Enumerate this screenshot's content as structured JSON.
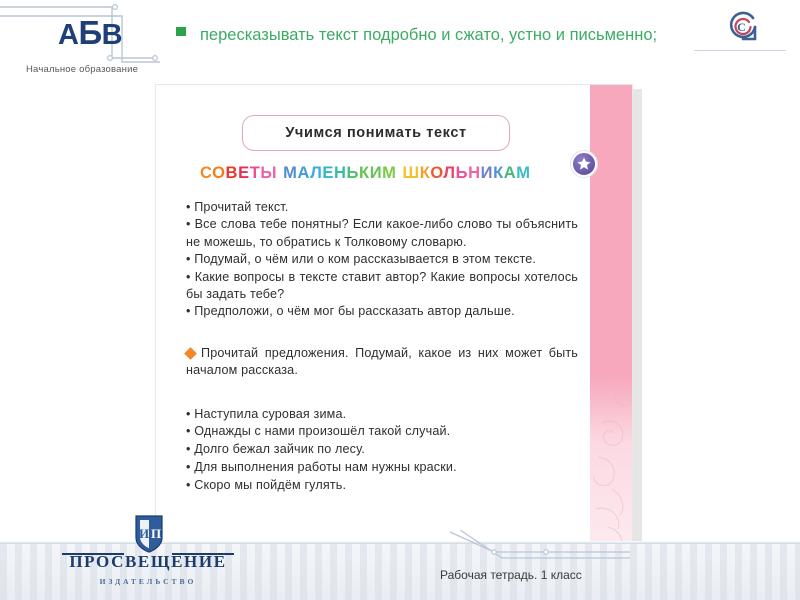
{
  "brand": {
    "logo_text_a": "А",
    "logo_text_b": "Б",
    "logo_text_v": "В",
    "subtitle": "Начальное образование",
    "corner_logo_icon": "spiral-circle-icon"
  },
  "header": {
    "bullet_icon": "square-bullet-icon",
    "text": "пересказывать текст подробно и сжато, устно и письменно;",
    "text_color": "#3cab63"
  },
  "book_page": {
    "title": "Учимся  понимать  текст",
    "title_border_color": "#e6a9b2",
    "pink_band_color": "#f7a8bd",
    "star_badge_icon": "star-badge-icon",
    "rainbow_heading": {
      "letters": [
        {
          "ch": "С",
          "color": "#f5891f"
        },
        {
          "ch": "О",
          "color": "#f07d20"
        },
        {
          "ch": "В",
          "color": "#e8392e"
        },
        {
          "ch": "Е",
          "color": "#e62e58"
        },
        {
          "ch": "Т",
          "color": "#ef4c8e"
        },
        {
          "ch": "Ы",
          "color": "#f062a8"
        },
        {
          "ch": " "
        },
        {
          "ch": "М",
          "color": "#4f8fd4"
        },
        {
          "ch": "А",
          "color": "#3f9ad8"
        },
        {
          "ch": "Л",
          "color": "#3aadd8"
        },
        {
          "ch": "Е",
          "color": "#2fb8c9"
        },
        {
          "ch": "Н",
          "color": "#33bda4"
        },
        {
          "ch": "Ь",
          "color": "#4cc06e"
        },
        {
          "ch": "К",
          "color": "#63c44f"
        },
        {
          "ch": "И",
          "color": "#63c44f"
        },
        {
          "ch": "М",
          "color": "#7dc94a"
        },
        {
          "ch": " "
        },
        {
          "ch": "Ш",
          "color": "#f2c22c"
        },
        {
          "ch": "К",
          "color": "#f2a22a"
        },
        {
          "ch": "О",
          "color": "#ec5a2c"
        },
        {
          "ch": "Л",
          "color": "#ea3f66"
        },
        {
          "ch": "Ь",
          "color": "#ee4f95"
        },
        {
          "ch": "Н",
          "color": "#ef62a6"
        },
        {
          "ch": "И",
          "color": "#6f7fd0"
        },
        {
          "ch": "К",
          "color": "#4f93d8"
        },
        {
          "ch": "А",
          "color": "#45b87a"
        },
        {
          "ch": "М",
          "color": "#3bbcc6"
        }
      ]
    },
    "tips": [
      "• Прочитай текст.",
      "• Все слова тебе понятны? Если какое-либо слово ты объяснить не можешь, то обратись к Толковому словарю.",
      "• Подумай, о чём или о ком рассказывается в этом тексте.",
      "• Какие вопросы в тексте ставит автор? Какие вопросы хотелось бы задать тебе?",
      "• Предположи, о чём мог бы рассказать автор дальше."
    ],
    "task": {
      "bullet_icon": "orange-diamond-icon",
      "bullet_color": "#f08a28",
      "text": "Прочитай предложения. Подумай, какое из них может быть началом рассказа."
    },
    "sentences": [
      "• Наступила  суровая  зима.",
      "• Однажды  с нами  произошёл  такой  случай.",
      "• Долго  бежал  зайчик  по  лесу.",
      "• Для  выполнения  работы  нам  нужны  краски.",
      "• Скоро  мы  пойдём  гулять."
    ]
  },
  "footer": {
    "publisher_name": "ПРОСВЕЩЕНИЕ",
    "publisher_sub": "ИЗДАТЕЛЬСТВО",
    "publisher_logo_icon": "shield-ip-icon",
    "caption": "Рабочая тетрадь. 1 класс",
    "swoosh_icon": "swoosh-lines-icon"
  }
}
